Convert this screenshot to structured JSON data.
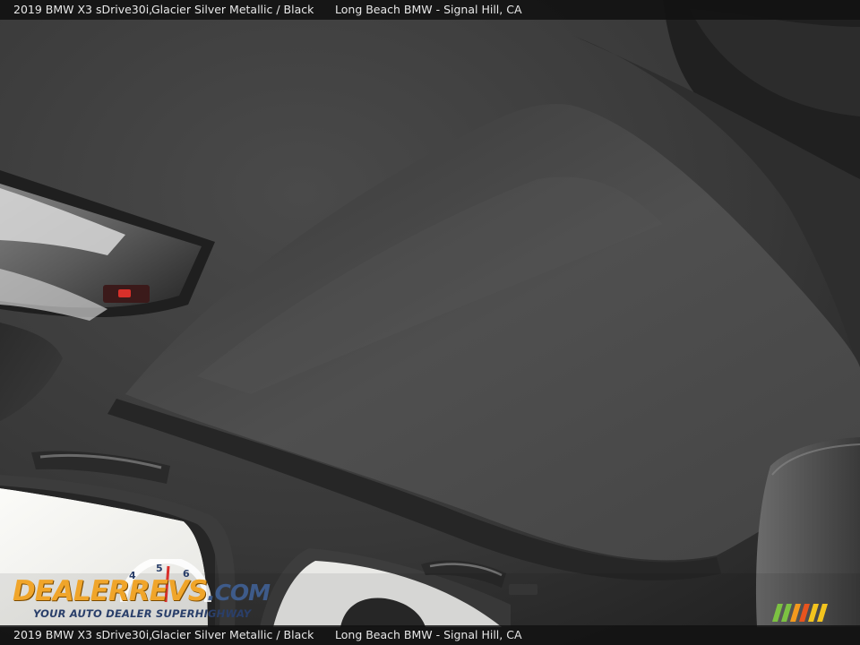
{
  "caption": {
    "model": "2019 BMW X3 sDrive30i,",
    "color": "Glacier Silver Metallic / Black",
    "dealer": "Long Beach BMW - Signal Hill, CA"
  },
  "watermark": {
    "word_dealer": "DEALER",
    "word_revs": "REVS",
    "word_com": ".COM",
    "tagline": "YOUR AUTO DEALER SUPERHIGHWAY",
    "colors": {
      "orange": "#f0a52a",
      "navy": "#2a3f6a",
      "red": "#d9302a"
    }
  },
  "palette": {
    "headliner": "#3a3a3a",
    "headliner_light": "#4c4c4c",
    "sunshade": "#4d4d4d",
    "window_glare": "#f2f2ef",
    "trim_dark": "#1c1c1c"
  }
}
